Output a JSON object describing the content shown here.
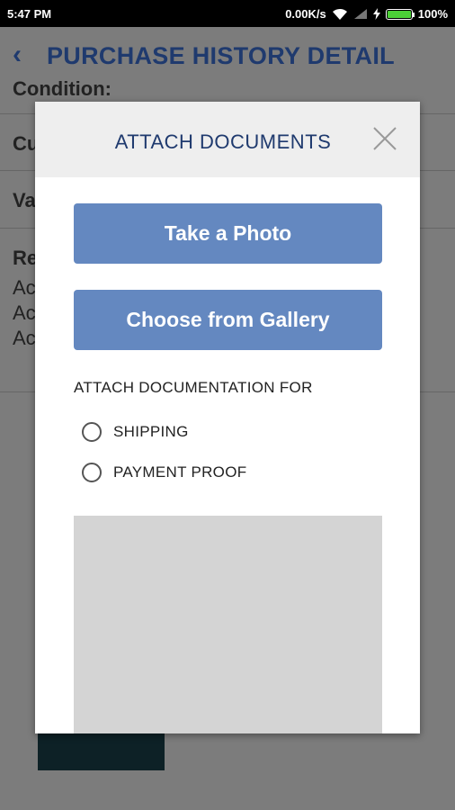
{
  "status_bar": {
    "time": "5:47 PM",
    "network_speed": "0.00K/s",
    "battery": "100%",
    "battery_level": 1.0,
    "icons": [
      "wifi-icon",
      "signal-icon",
      "charging-icon",
      "battery-icon"
    ]
  },
  "app_bar": {
    "title": "PURCHASE HISTORY DETAIL",
    "back_icon": "chevron-left-icon"
  },
  "background": {
    "condition_label": "Condition:",
    "row2_label": "Cu",
    "row3_label": "Va",
    "row4_label": "Re",
    "row4_lines": [
      "Ac",
      "Ac",
      "Ac"
    ]
  },
  "modal": {
    "title": "ATTACH DOCUMENTS",
    "close_icon": "close-icon",
    "take_photo_label": "Take a Photo",
    "gallery_label": "Choose from Gallery",
    "section_label": "ATTACH DOCUMENTATION FOR",
    "options": [
      "SHIPPING",
      "PAYMENT PROOF"
    ]
  },
  "colors": {
    "accent": "#6488c0",
    "title": "#1f3a6e",
    "header_bg": "#eeeeee",
    "preview_bg": "#d4d4d4"
  }
}
